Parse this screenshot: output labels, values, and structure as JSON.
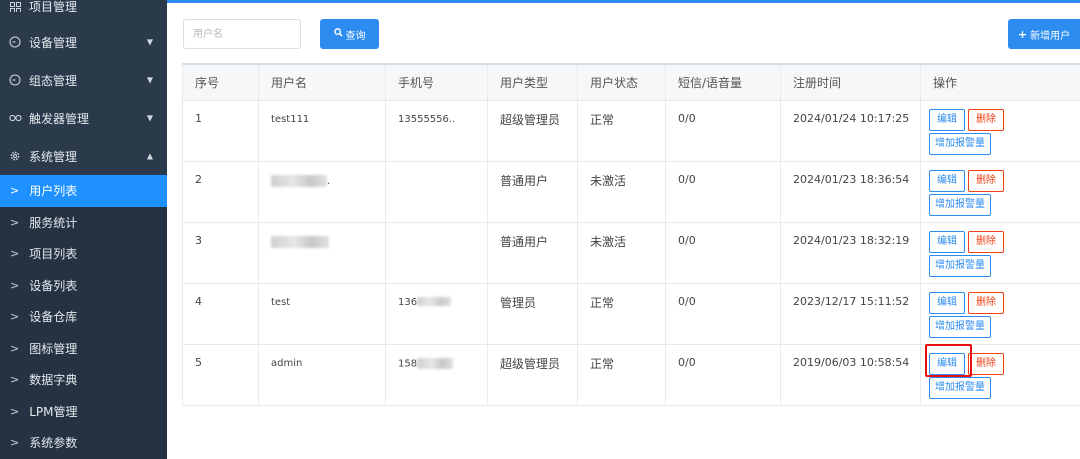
{
  "sidebar": {
    "top_item": {
      "label": "项目管理",
      "icon": "grid-icon"
    },
    "menus": [
      {
        "label": "设备管理",
        "icon": "target-icon",
        "expanded": false
      },
      {
        "label": "组态管理",
        "icon": "target-icon",
        "expanded": false
      },
      {
        "label": "触发器管理",
        "icon": "link-icon",
        "expanded": false
      },
      {
        "label": "系统管理",
        "icon": "gear-icon",
        "expanded": true
      }
    ],
    "submenu": [
      {
        "label": "用户列表",
        "active": true
      },
      {
        "label": "服务统计"
      },
      {
        "label": "项目列表"
      },
      {
        "label": "设备列表"
      },
      {
        "label": "设备仓库"
      },
      {
        "label": "图标管理"
      },
      {
        "label": "数据字典"
      },
      {
        "label": "LPM管理"
      },
      {
        "label": "系统参数"
      }
    ]
  },
  "toolbar": {
    "search_placeholder": "用户名",
    "query_label": "查询",
    "add_label": "新增用户"
  },
  "table": {
    "headers": [
      "序号",
      "用户名",
      "手机号",
      "用户类型",
      "用户状态",
      "短信/语音量",
      "注册时间",
      "操作"
    ],
    "rows": [
      {
        "no": "1",
        "username": "test111",
        "phone": "13555556..",
        "type": "超级管理员",
        "status": "正常",
        "quota": "0/0",
        "time": "2024/01/24 10:17:25"
      },
      {
        "no": "2",
        "username": ".",
        "phone": "",
        "type": "普通用户",
        "status": "未激活",
        "quota": "0/0",
        "time": "2024/01/23 18:36:54"
      },
      {
        "no": "3",
        "username": "",
        "phone": "",
        "type": "普通用户",
        "status": "未激活",
        "quota": "0/0",
        "time": "2024/01/23 18:32:19"
      },
      {
        "no": "4",
        "username": "test",
        "phone": "136",
        "type": "管理员",
        "status": "正常",
        "quota": "0/0",
        "time": "2023/12/17 15:11:52"
      },
      {
        "no": "5",
        "username": "admin",
        "phone": "158",
        "type": "超级管理员",
        "status": "正常",
        "quota": "0/0",
        "time": "2019/06/03 10:58:54"
      }
    ],
    "actions": {
      "edit": "编辑",
      "delete": "删除",
      "alarm": "增加报警量"
    }
  },
  "colors": {
    "accent": "#2d8cf0",
    "danger": "#ed4014",
    "sidebar_bg": "#2b3a4b",
    "active_menu": "#1e90ff",
    "highlight": "#e81010"
  }
}
